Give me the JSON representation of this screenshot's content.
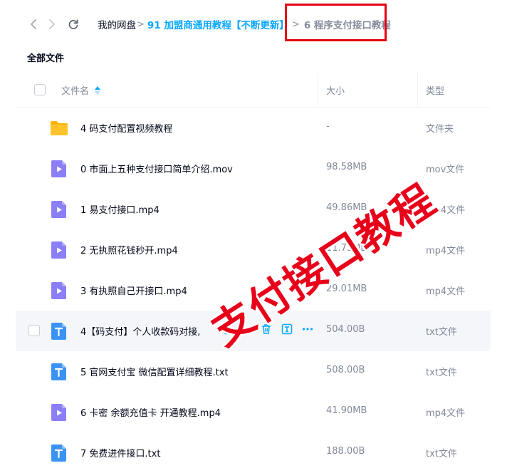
{
  "breadcrumb": {
    "root": "我的网盘",
    "separator": ">",
    "parent": "91 加盟商通用教程【不断更新】",
    "current": "6 程序支付接口教程"
  },
  "section_title": "全部文件",
  "columns": {
    "name": "文件名",
    "size": "大小",
    "type": "类型"
  },
  "files": [
    {
      "name": "4 码支付配置视频教程",
      "size": "-",
      "type": "文件夹",
      "icon": "folder-icon"
    },
    {
      "name": "0 市面上五种支付接口简单介绍.mov",
      "size": "98.58MB",
      "type": "mov文件",
      "icon": "video-file-icon"
    },
    {
      "name": "1 易支付接口.mp4",
      "size": "49.86MB",
      "type": "mp4文件",
      "icon": "video-file-icon"
    },
    {
      "name": "2 无执照花钱秒开.mp4",
      "size": "11.73MB",
      "type": "mp4文件",
      "icon": "video-file-icon"
    },
    {
      "name": "3 有执照自己开接口.mp4",
      "size": "29.01MB",
      "type": "mp4文件",
      "icon": "video-file-icon"
    },
    {
      "name": "4【码支付】个人收款码对接,",
      "size": "504.00B",
      "type": "txt文件",
      "icon": "text-file-icon",
      "hovered": true
    },
    {
      "name": "5 官网支付宝 微信配置详细教程.txt",
      "size": "508.00B",
      "type": "txt文件",
      "icon": "text-file-icon"
    },
    {
      "name": "6 卡密 余额充值卡 开通教程.mp4",
      "size": "41.90MB",
      "type": "mp4文件",
      "icon": "video-file-icon"
    },
    {
      "name": "7 免费进件接口.txt",
      "size": "188.00B",
      "type": "txt文件",
      "icon": "text-file-icon"
    }
  ],
  "watermark": "支付接口教程",
  "colors": {
    "accent": "#06a7ff",
    "highlight": "#e60012",
    "watermark": "#e8001a",
    "video_icon": "#8a7ff7",
    "text_icon": "#3b92f5",
    "folder_icon": "#ffc42c"
  }
}
